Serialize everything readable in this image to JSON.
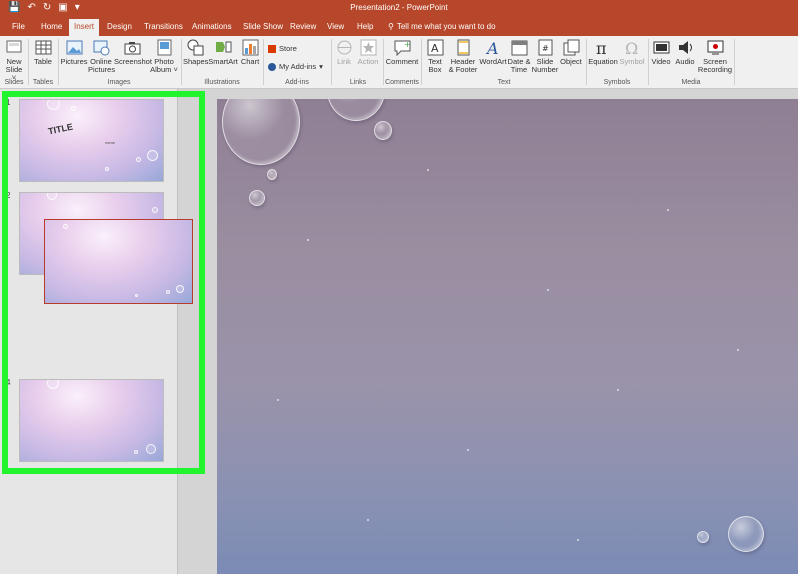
{
  "titlebar": {
    "title": "Presentation2 - PowerPoint"
  },
  "tabs": [
    "File",
    "Home",
    "Insert",
    "Design",
    "Transitions",
    "Animations",
    "Slide Show",
    "Review",
    "View",
    "Help"
  ],
  "active_tab": "Insert",
  "tell_me": "Tell me what you want to do",
  "ribbon": {
    "slides": {
      "new_slide_1": "New",
      "new_slide_2": "Slide ˅",
      "group": "Slides"
    },
    "tables": {
      "table": "Table",
      "group": "Tables"
    },
    "images": {
      "pictures": "Pictures",
      "online_1": "Online",
      "online_2": "Pictures",
      "screenshot": "Screenshot",
      "photo_1": "Photo",
      "photo_2": "Album ˅",
      "group": "Images"
    },
    "illustrations": {
      "shapes": "Shapes",
      "smartart": "SmartArt",
      "chart": "Chart",
      "group": "Illustrations"
    },
    "addins": {
      "store": "Store",
      "my_addins": "My Add-ins",
      "group": "Add-ins"
    },
    "links": {
      "link": "Link",
      "action": "Action",
      "group": "Links"
    },
    "comments": {
      "comment": "Comment",
      "group": "Comments"
    },
    "text": {
      "textbox_1": "Text",
      "textbox_2": "Box",
      "header_1": "Header",
      "header_2": "& Footer",
      "wordart": "WordArt",
      "date_1": "Date &",
      "date_2": "Time",
      "slidenum_1": "Slide",
      "slidenum_2": "Number",
      "object": "Object",
      "group": "Text"
    },
    "symbols": {
      "equation": "Equation",
      "symbol": "Symbol",
      "group": "Symbols"
    },
    "media": {
      "video": "Video",
      "audio": "Audio",
      "rec_1": "Screen",
      "rec_2": "Recording",
      "group": "Media"
    }
  },
  "thumbnails": [
    {
      "num": "1",
      "title": "TITLE",
      "subtitle": "name"
    },
    {
      "num": "2"
    },
    {
      "num": "4"
    }
  ],
  "colors": {
    "accent": "#b7472a",
    "highlight": "#22f52e"
  }
}
